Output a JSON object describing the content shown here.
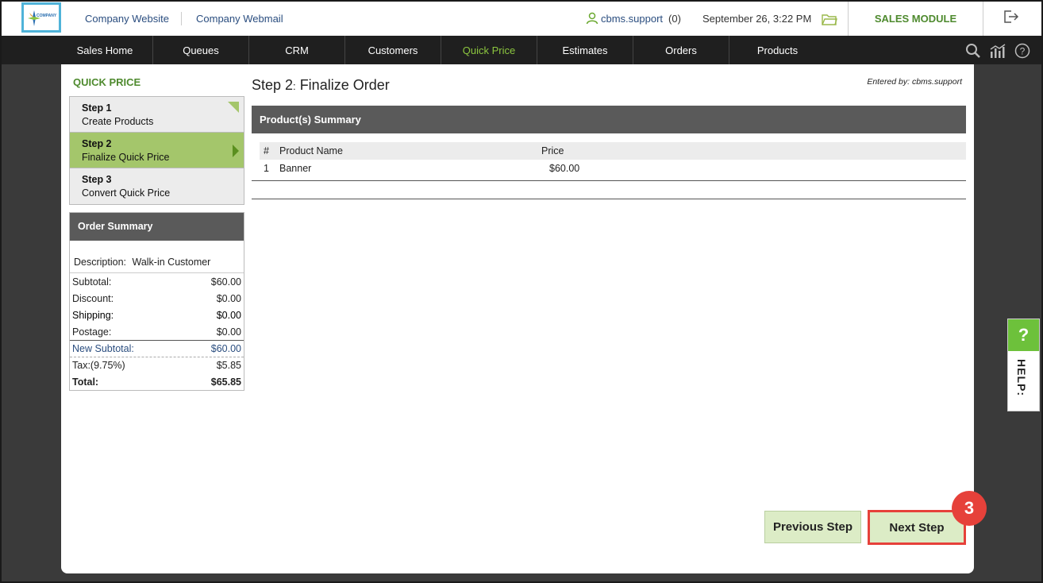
{
  "topbar": {
    "logo_text": "COMPANY",
    "links": [
      "Company Website",
      "Company Webmail"
    ],
    "user": "cbms.support",
    "user_count": "(0)",
    "datetime": "September 26, 3:22 PM",
    "module": "SALES MODULE"
  },
  "nav": {
    "items": [
      "Sales Home",
      "Queues",
      "CRM",
      "Customers",
      "Quick Price",
      "Estimates",
      "Orders",
      "Products"
    ],
    "active": "Quick Price",
    "tool_icons": [
      "search-icon",
      "chart-icon",
      "help-icon"
    ]
  },
  "sidebar": {
    "title": "QUICK PRICE",
    "steps": [
      {
        "num": "Step 1",
        "label": "Create Products"
      },
      {
        "num": "Step 2",
        "label": "Finalize Quick Price"
      },
      {
        "num": "Step 3",
        "label": "Convert Quick Price"
      }
    ],
    "order_summary": {
      "title": "Order Summary",
      "description_label": "Description:",
      "description_value": "Walk-in Customer",
      "rows": [
        {
          "label": "Subtotal:",
          "value": "$60.00"
        },
        {
          "label": "Discount:",
          "value": "$0.00"
        },
        {
          "label": "Shipping:",
          "value": "$0.00"
        },
        {
          "label": "Postage:",
          "value": "$0.00"
        },
        {
          "label": "New Subtotal:",
          "value": "$60.00"
        },
        {
          "label": "Tax:(9.75%)",
          "value": "$5.85"
        },
        {
          "label": "Total:",
          "value": "$65.85"
        }
      ]
    }
  },
  "main": {
    "step_prefix": "Step 2",
    "step_sep": ":",
    "step_title": "Finalize Order",
    "entered_by": "Entered by: cbms.support",
    "summary_title": "Product(s) Summary",
    "table": {
      "headers": [
        "#",
        "Product Name",
        "Price"
      ],
      "rows": [
        [
          "1",
          "Banner",
          "$60.00"
        ]
      ]
    },
    "buttons": {
      "previous": "Previous Step",
      "next": "Next Step"
    },
    "badge": "3"
  },
  "help": {
    "symbol": "?",
    "label": "HELP:"
  },
  "colors": {
    "accent": "#4e8a2e",
    "active_step": "#a4c66b",
    "nav_bg": "#1f1f1f",
    "highlight": "#e6413a"
  }
}
